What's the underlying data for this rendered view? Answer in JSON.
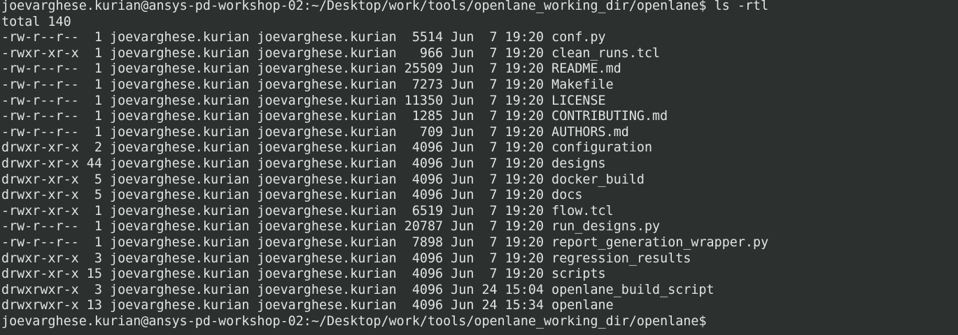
{
  "terminal": {
    "prompt": "joevarghese.kurian@ansys-pd-workshop-02:~/Desktop/work/tools/openlane_working_dir/openlane$",
    "command": "ls -rtl",
    "total_line": "total 140",
    "listing": [
      "-rw-r--r--  1 joevarghese.kurian joevarghese.kurian  5514 Jun  7 19:20 conf.py",
      "-rwxr-xr-x  1 joevarghese.kurian joevarghese.kurian   966 Jun  7 19:20 clean_runs.tcl",
      "-rw-r--r--  1 joevarghese.kurian joevarghese.kurian 25509 Jun  7 19:20 README.md",
      "-rw-r--r--  1 joevarghese.kurian joevarghese.kurian  7273 Jun  7 19:20 Makefile",
      "-rw-r--r--  1 joevarghese.kurian joevarghese.kurian 11350 Jun  7 19:20 LICENSE",
      "-rw-r--r--  1 joevarghese.kurian joevarghese.kurian  1285 Jun  7 19:20 CONTRIBUTING.md",
      "-rw-r--r--  1 joevarghese.kurian joevarghese.kurian   709 Jun  7 19:20 AUTHORS.md",
      "drwxr-xr-x  2 joevarghese.kurian joevarghese.kurian  4096 Jun  7 19:20 configuration",
      "drwxr-xr-x 44 joevarghese.kurian joevarghese.kurian  4096 Jun  7 19:20 designs",
      "drwxr-xr-x  5 joevarghese.kurian joevarghese.kurian  4096 Jun  7 19:20 docker_build",
      "drwxr-xr-x  5 joevarghese.kurian joevarghese.kurian  4096 Jun  7 19:20 docs",
      "-rwxr-xr-x  1 joevarghese.kurian joevarghese.kurian  6519 Jun  7 19:20 flow.tcl",
      "-rw-r--r--  1 joevarghese.kurian joevarghese.kurian 20787 Jun  7 19:20 run_designs.py",
      "-rw-r--r--  1 joevarghese.kurian joevarghese.kurian  7898 Jun  7 19:20 report_generation_wrapper.py",
      "drwxr-xr-x  3 joevarghese.kurian joevarghese.kurian  4096 Jun  7 19:20 regression_results",
      "drwxr-xr-x 15 joevarghese.kurian joevarghese.kurian  4096 Jun  7 19:20 scripts",
      "drwxrwxr-x  3 joevarghese.kurian joevarghese.kurian  4096 Jun 24 15:04 openlane_build_script",
      "drwxrwxr-x 13 joevarghese.kurian joevarghese.kurian  4096 Jun 24 15:34 openlane"
    ],
    "colors": {
      "background": "#2c3130",
      "foreground": "#e3e3e3"
    }
  }
}
